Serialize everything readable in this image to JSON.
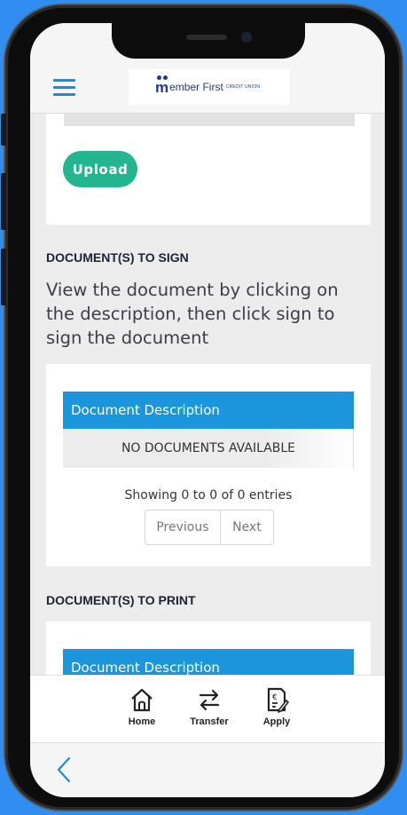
{
  "header": {
    "logo_main": "ember First",
    "logo_sub": "CREDIT UNION"
  },
  "upload": {
    "button_label": "Upload"
  },
  "sign_section": {
    "title": "DOCUMENT(S) TO SIGN",
    "description": "View the document by clicking on the description, then click sign to sign the document",
    "table_header": "Document Description",
    "empty_text": "NO DOCUMENTS AVAILABLE",
    "entries_text": "Showing 0 to 0 of 0 entries",
    "prev_label": "Previous",
    "next_label": "Next"
  },
  "print_section": {
    "title": "DOCUMENT(S) TO PRINT",
    "table_header": "Document Description"
  },
  "tabs": [
    {
      "label": "Home",
      "icon": "home-icon"
    },
    {
      "label": "Transfer",
      "icon": "transfer-icon"
    },
    {
      "label": "Apply",
      "icon": "apply-document-icon"
    }
  ],
  "colors": {
    "accent_blue": "#1b95dc",
    "upload_green": "#22b58f",
    "background": "#2f8ef0"
  }
}
